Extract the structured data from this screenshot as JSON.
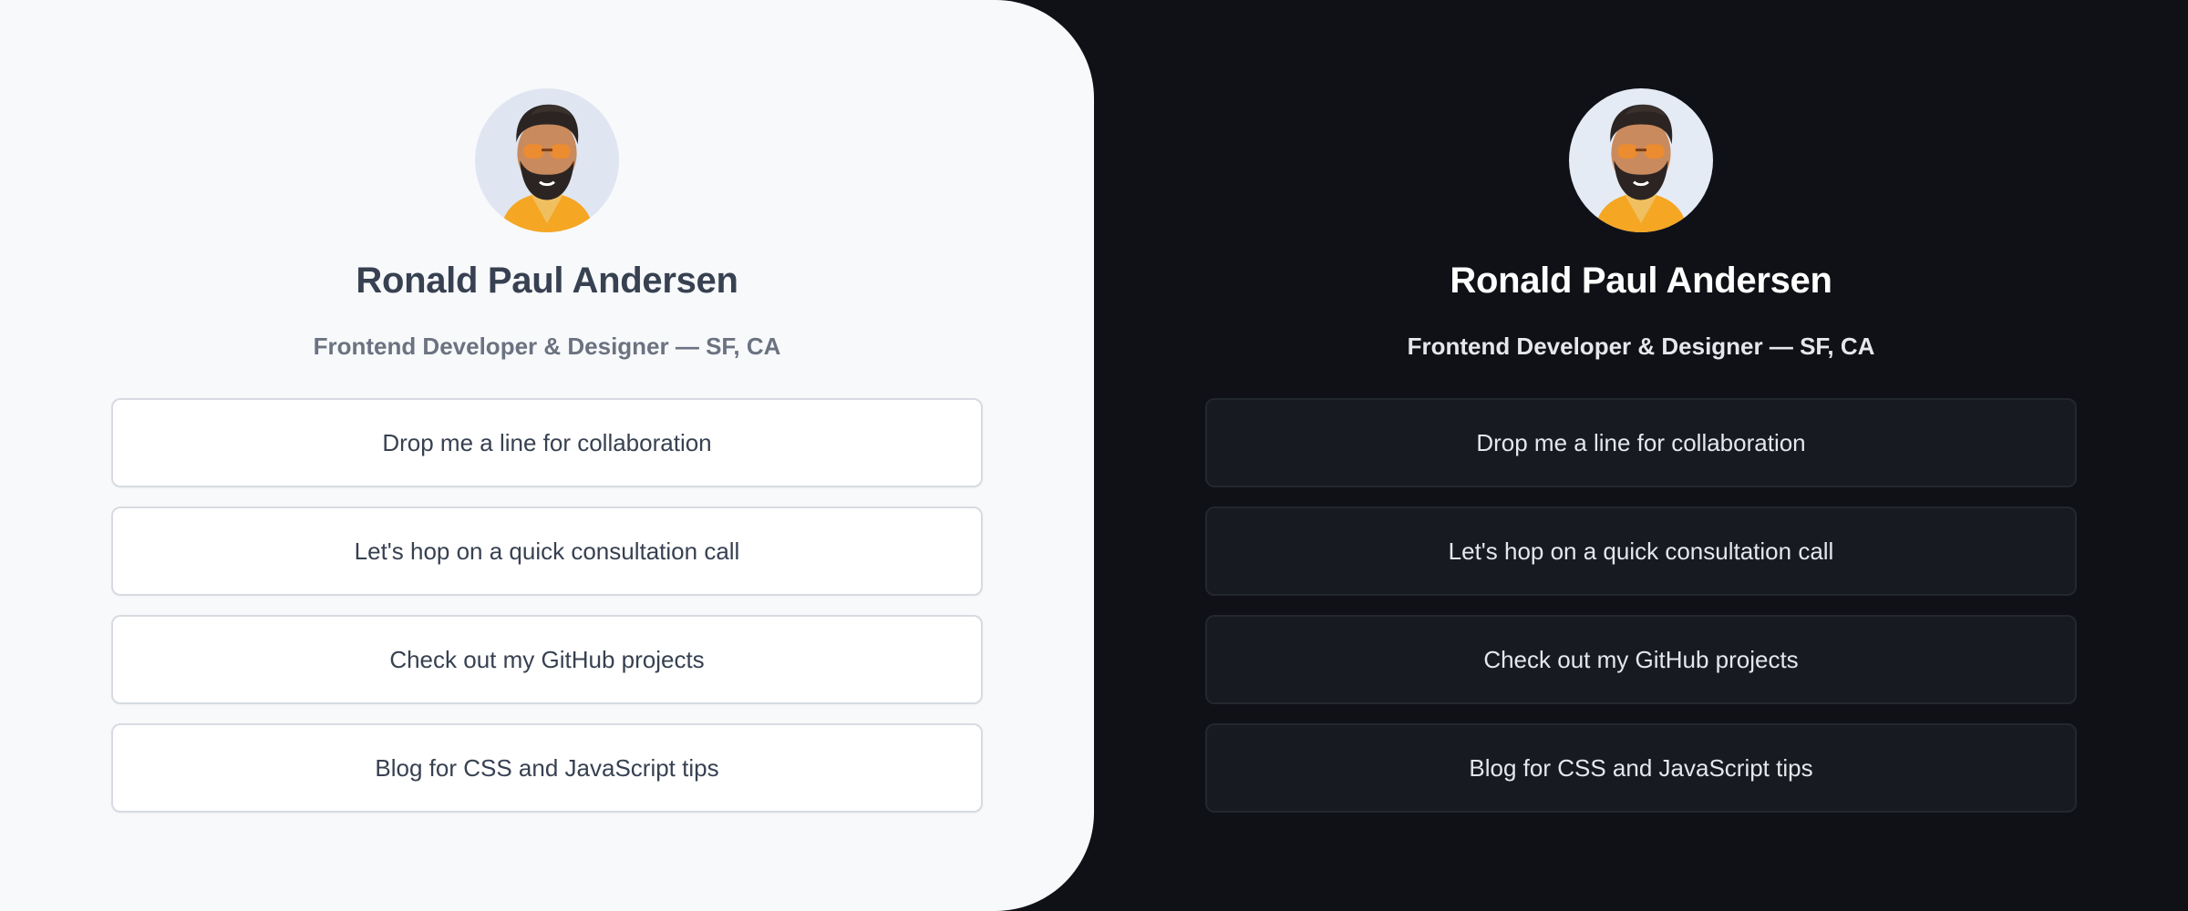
{
  "light_theme": {
    "profile": {
      "name": "Ronald Paul Andersen",
      "subtitle": "Frontend Developer & Designer — SF, CA",
      "avatar_icon": "memoji-avatar"
    },
    "links": [
      "Drop me a line for collaboration",
      "Let's hop on a quick consultation call",
      "Check out my GitHub projects",
      "Blog for CSS and JavaScript tips"
    ],
    "colors": {
      "background": "#f8f9fb",
      "button_background": "#ffffff",
      "button_border": "#d7dbe1",
      "name_text": "#374151",
      "subtitle_text": "#6b7280"
    }
  },
  "dark_theme": {
    "profile": {
      "name": "Ronald Paul Andersen",
      "subtitle": "Frontend Developer & Designer — SF, CA",
      "avatar_icon": "memoji-avatar"
    },
    "links": [
      "Drop me a line for collaboration",
      "Let's hop on a quick consultation call",
      "Check out my GitHub projects",
      "Blog for CSS and JavaScript tips"
    ],
    "colors": {
      "background": "#0f1117",
      "button_background": "#171a20",
      "button_border": "#23272e",
      "name_text": "#ffffff",
      "subtitle_text": "#e5e7eb"
    }
  }
}
